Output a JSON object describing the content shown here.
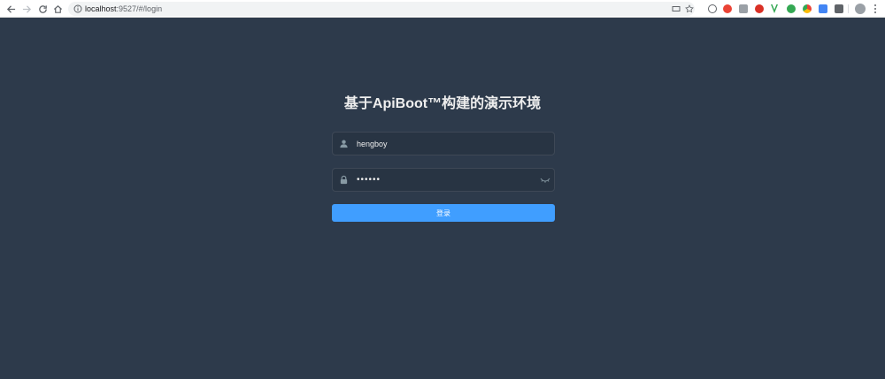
{
  "browser": {
    "url_host": "localhost",
    "url_path": ":9527/#/login",
    "extension_colors": [
      "#5f6368",
      "#ea4335",
      "#9aa0a6",
      "#d93025",
      "#34a853",
      "#34a853",
      "#fbbc05",
      "#4285f4",
      "#5f6368"
    ]
  },
  "login": {
    "title": "基于ApiBoot™构建的演示环境",
    "username_value": "hengboy",
    "password_value": "••••••",
    "submit_label": "登录"
  },
  "colors": {
    "background": "#2d3a4b",
    "title_text": "#eeeeee",
    "icon": "#889aa4",
    "button": "#409eff"
  }
}
